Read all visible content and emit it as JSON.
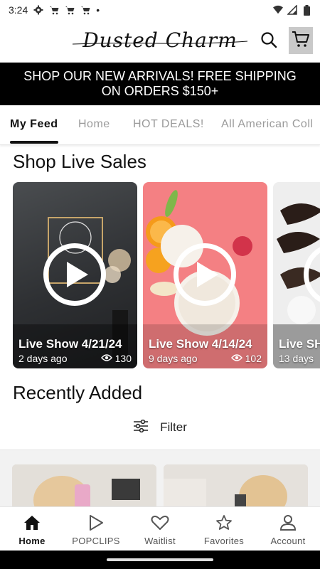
{
  "status_bar": {
    "time": "3:24",
    "dot": "•",
    "icons": [
      "gear-icon",
      "cart-icon",
      "cart-icon",
      "cart-icon",
      "wifi-icon",
      "signal-icon",
      "battery-icon"
    ]
  },
  "header": {
    "logo_text": "Dusted Charm",
    "search_icon": "search-icon",
    "cart_icon": "cart-icon"
  },
  "banner": {
    "text": "SHOP OUR NEW ARRIVALS! FREE SHIPPING ON ORDERS $150+"
  },
  "tabs": [
    {
      "label": "My Feed",
      "active": true
    },
    {
      "label": "Home",
      "active": false
    },
    {
      "label": "HOT DEALS!",
      "active": false
    },
    {
      "label": "All American Coll",
      "active": false
    }
  ],
  "live_section": {
    "title": "Shop Live Sales",
    "cards": [
      {
        "title": "Live Show 4/21/24",
        "ago": "2 days ago",
        "views": "130"
      },
      {
        "title": "Live Show 4/14/24",
        "ago": "9 days ago",
        "views": "102"
      },
      {
        "title": "Live SH",
        "ago": "13 days",
        "views": ""
      }
    ]
  },
  "recent_section": {
    "title": "Recently Added",
    "filter_label": "Filter"
  },
  "bottom_nav": [
    {
      "label": "Home",
      "icon": "home-icon",
      "active": true
    },
    {
      "label": "POPCLIPS",
      "icon": "play-outline-icon",
      "active": false
    },
    {
      "label": "Waitlist",
      "icon": "heart-icon",
      "active": false
    },
    {
      "label": "Favorites",
      "icon": "star-icon",
      "active": false
    },
    {
      "label": "Account",
      "icon": "account-icon",
      "active": false
    }
  ],
  "colors": {
    "banner_bg": "#000000",
    "banner_text": "#ffffff",
    "cart_bg": "#c9c9c9",
    "accent": "#111111"
  }
}
